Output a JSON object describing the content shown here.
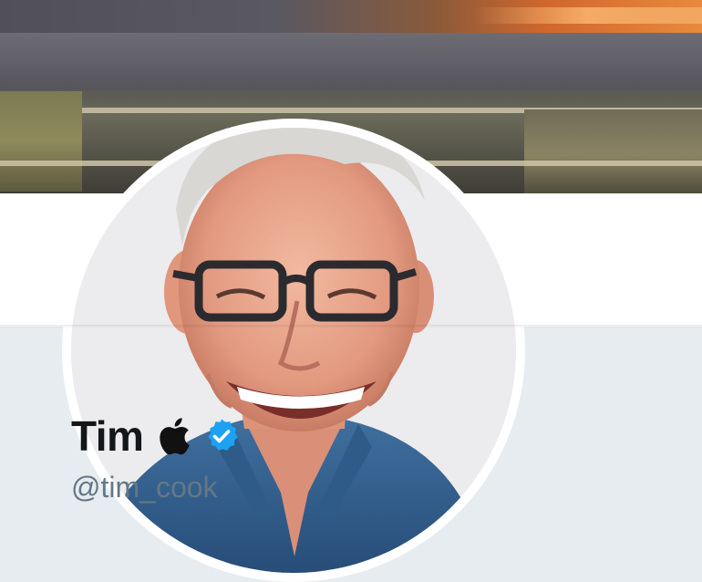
{
  "profile": {
    "display_name": "Tim",
    "handle": "@tim_cook",
    "verified": true
  },
  "icons": {
    "name_emoji": "apple-logo-icon",
    "badge": "verified-badge-icon"
  },
  "colors": {
    "verified_blue": "#1da1f2",
    "name_text": "#14171a",
    "handle_text": "#657786",
    "background": "#e6ecf0"
  }
}
